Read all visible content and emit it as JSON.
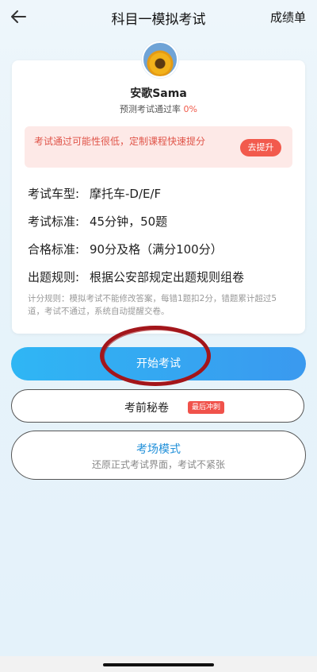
{
  "header": {
    "title": "科目一模拟考试",
    "right_action": "成绩单"
  },
  "user": {
    "name": "安歌Sama",
    "pass_rate_label": "预测考试通过率",
    "pass_rate_value": "0%"
  },
  "warning": {
    "text": "考试通过可能性很低，定制课程快速提分",
    "button": "去提升"
  },
  "info": [
    {
      "label": "考试车型:",
      "value": "摩托车-D/E/F"
    },
    {
      "label": "考试标准:",
      "value": "45分钟，50题"
    },
    {
      "label": "合格标准:",
      "value": "90分及格（满分100分）"
    },
    {
      "label": "出题规则:",
      "value": "根据公安部规定出题规则组卷"
    }
  ],
  "note": "计分规则：模拟考试不能修改答案，每错1题扣2分，错题累计超过5道，考试不通过，系统自动提醒交卷。",
  "buttons": {
    "start": "开始考试",
    "secret": "考前秘卷",
    "secret_badge": "最后冲刺",
    "mode_title": "考场模式",
    "mode_sub": "还原正式考试界面，考试不紧张"
  },
  "colors": {
    "accent": "#3a99ef",
    "warning": "#f25a4d",
    "annotation_ring": "#a3161b"
  }
}
